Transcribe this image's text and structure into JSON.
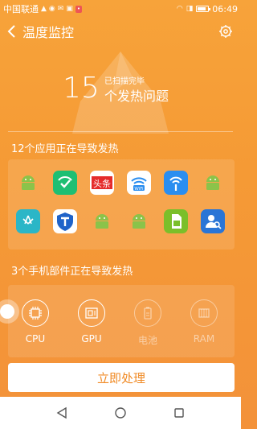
{
  "status_bar": {
    "carrier": "中国联通",
    "time": "06:49",
    "battery_level": 0.85
  },
  "header": {
    "title": "温度监控",
    "back_icon": "chevron-left-icon",
    "settings_icon": "gear-icon"
  },
  "hero": {
    "count": "15",
    "scan_status": "已扫描完毕",
    "issue_label": "个发热问题"
  },
  "apps_section": {
    "title": "12个应用正在导致发热",
    "apps": [
      {
        "icon": "android-icon",
        "color": "#8bc34a"
      },
      {
        "icon": "shield-check-icon",
        "color": "#1dbf73"
      },
      {
        "icon": "toutiao-icon",
        "label": "头条",
        "color": "#e52b2b"
      },
      {
        "icon": "wifi-icon",
        "label": "WiFi",
        "color": "#2a8ef0"
      },
      {
        "icon": "wifi-hotspot-icon",
        "color": "#2a8ef0"
      },
      {
        "icon": "android-icon",
        "color": "#8bc34a"
      },
      {
        "icon": "huawei-icon",
        "color": "#2bb6c7"
      },
      {
        "icon": "shield-t-icon",
        "color": "#2063c9"
      },
      {
        "icon": "android-icon",
        "color": "#8bc34a"
      },
      {
        "icon": "android-icon",
        "color": "#8bc34a"
      },
      {
        "icon": "sim-card-icon",
        "color": "#7bbf2a"
      },
      {
        "icon": "contacts-search-icon",
        "color": "#2a75d6"
      }
    ]
  },
  "parts_section": {
    "title": "3个手机部件正在导致发热",
    "parts": [
      {
        "label": "CPU",
        "icon": "cpu-icon",
        "active": true
      },
      {
        "label": "GPU",
        "icon": "gpu-icon",
        "active": true
      },
      {
        "label": "电池",
        "icon": "battery-icon",
        "active": false
      },
      {
        "label": "RAM",
        "icon": "ram-icon",
        "active": false
      }
    ]
  },
  "action": {
    "label": "立即处理"
  },
  "nav": {
    "back": "back-triangle-icon",
    "home": "home-circle-icon",
    "recents": "recents-square-icon"
  }
}
